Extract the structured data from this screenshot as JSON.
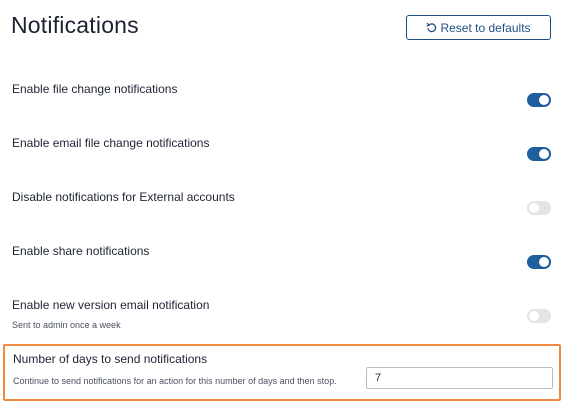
{
  "header": {
    "title": "Notifications",
    "reset_label": "Reset to defaults",
    "reset_icon": "rotate-ccw-icon"
  },
  "settings": [
    {
      "label": "Enable file change notifications",
      "description": "",
      "enabled": true
    },
    {
      "label": "Enable email file change notifications",
      "description": "",
      "enabled": true
    },
    {
      "label": "Disable notifications for External accounts",
      "description": "",
      "enabled": false
    },
    {
      "label": "Enable share notifications",
      "description": "",
      "enabled": true
    },
    {
      "label": "Enable new version email notification",
      "description": "Sent to admin once a week",
      "enabled": false
    }
  ],
  "days_setting": {
    "label": "Number of days to send notifications",
    "description": "Continue to send notifications for an action for this number of days and then stop.",
    "value": "7"
  },
  "colors": {
    "toggle_on": "#1f5f9e",
    "toggle_off": "#e4e4e6",
    "button_border": "#1f4f82",
    "highlight_border": "#f08a43"
  }
}
